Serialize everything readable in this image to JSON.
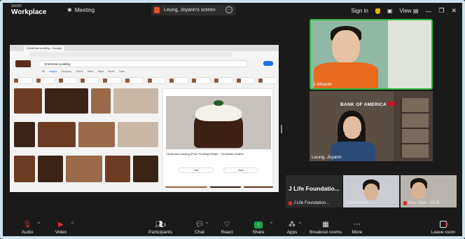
{
  "app": {
    "brand_top": "zoom",
    "brand_name": "Workplace",
    "meeting_label": "Meeting",
    "screen_share_label": "Leung, Joyann's screen",
    "sign_in": "Sign in",
    "view": "View"
  },
  "shared_screen": {
    "search_query": "Christmas pudding",
    "tabs": [
      "All",
      "Images",
      "Shopping",
      "Videos",
      "News",
      "Maps",
      "Books",
      "Tools"
    ],
    "preview_title": "Christmas Pudding (Plum Pudding Recipe - Christmas Cuisine",
    "preview_btn_visit": "Visit",
    "preview_btn_save": "Save"
  },
  "participants": {
    "miracle": "1-Miracle",
    "leung": "Leung, Joyann",
    "bofa_text": "BANK OF AMERICA",
    "jlife_name": "J Life Foundatio...",
    "jlife_label": "J Life Foundation...",
    "chang": "CHANGYIN",
    "hsu": "Hsu, Sam - GCB"
  },
  "toolbar": {
    "audio": "Audio",
    "video": "Video",
    "participants": "Participants",
    "participants_count": "5",
    "chat": "Chat",
    "react": "React",
    "share": "Share",
    "apps": "Apps",
    "breakout": "Breakout rooms",
    "more": "More",
    "leave": "Leave room"
  },
  "colors": {
    "accent_green": "#2fb344",
    "share_green": "#1aa34a",
    "muted_red": "#e02b2b",
    "frame": "#cfe3ee"
  }
}
